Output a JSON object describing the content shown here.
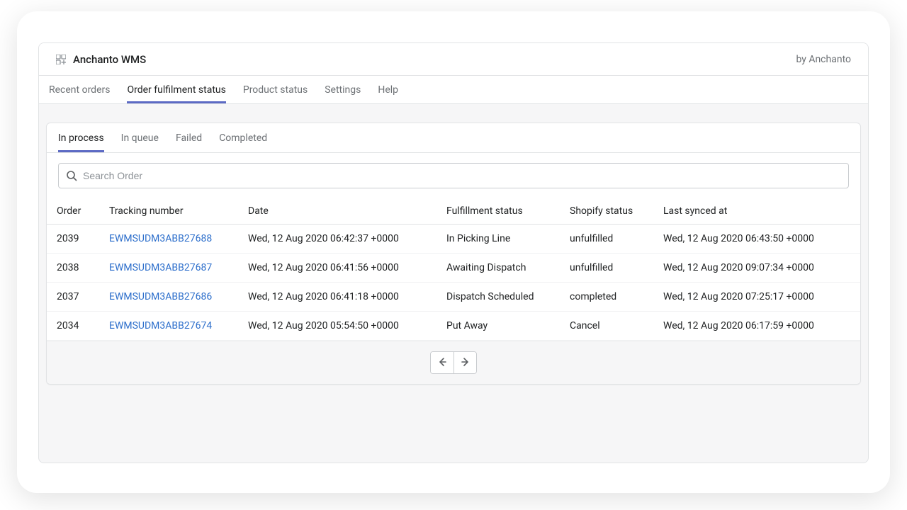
{
  "header": {
    "app_title": "Anchanto WMS",
    "by_text": "by Anchanto"
  },
  "primary_tabs": [
    {
      "label": "Recent orders"
    },
    {
      "label": "Order fulfilment status"
    },
    {
      "label": "Product status"
    },
    {
      "label": "Settings"
    },
    {
      "label": "Help"
    }
  ],
  "secondary_tabs": [
    {
      "label": "In process"
    },
    {
      "label": "In queue"
    },
    {
      "label": "Failed"
    },
    {
      "label": "Completed"
    }
  ],
  "search": {
    "placeholder": "Search Order",
    "value": ""
  },
  "columns": {
    "order": "Order",
    "tracking": "Tracking number",
    "date": "Date",
    "fulfil": "Fulfillment status",
    "shopify": "Shopify status",
    "synced": "Last synced at"
  },
  "rows": [
    {
      "order": "2039",
      "tracking": "EWMSUDM3ABB27688",
      "date": "Wed, 12 Aug 2020 06:42:37 +0000",
      "fulfil": "In Picking Line",
      "shopify": "unfulfilled",
      "synced": "Wed, 12 Aug 2020 06:43:50 +0000"
    },
    {
      "order": "2038",
      "tracking": "EWMSUDM3ABB27687",
      "date": "Wed, 12 Aug 2020 06:41:56 +0000",
      "fulfil": "Awaiting Dispatch",
      "shopify": "unfulfilled",
      "synced": "Wed, 12 Aug 2020 09:07:34 +0000"
    },
    {
      "order": "2037",
      "tracking": "EWMSUDM3ABB27686",
      "date": "Wed, 12 Aug 2020 06:41:18 +0000",
      "fulfil": "Dispatch Scheduled",
      "shopify": "completed",
      "synced": "Wed, 12 Aug 2020 07:25:17 +0000"
    },
    {
      "order": "2034",
      "tracking": "EWMSUDM3ABB27674",
      "date": "Wed, 12 Aug 2020 05:54:50 +0000",
      "fulfil": "Put Away",
      "shopify": "Cancel",
      "synced": "Wed, 12 Aug 2020 06:17:59 +0000"
    }
  ]
}
